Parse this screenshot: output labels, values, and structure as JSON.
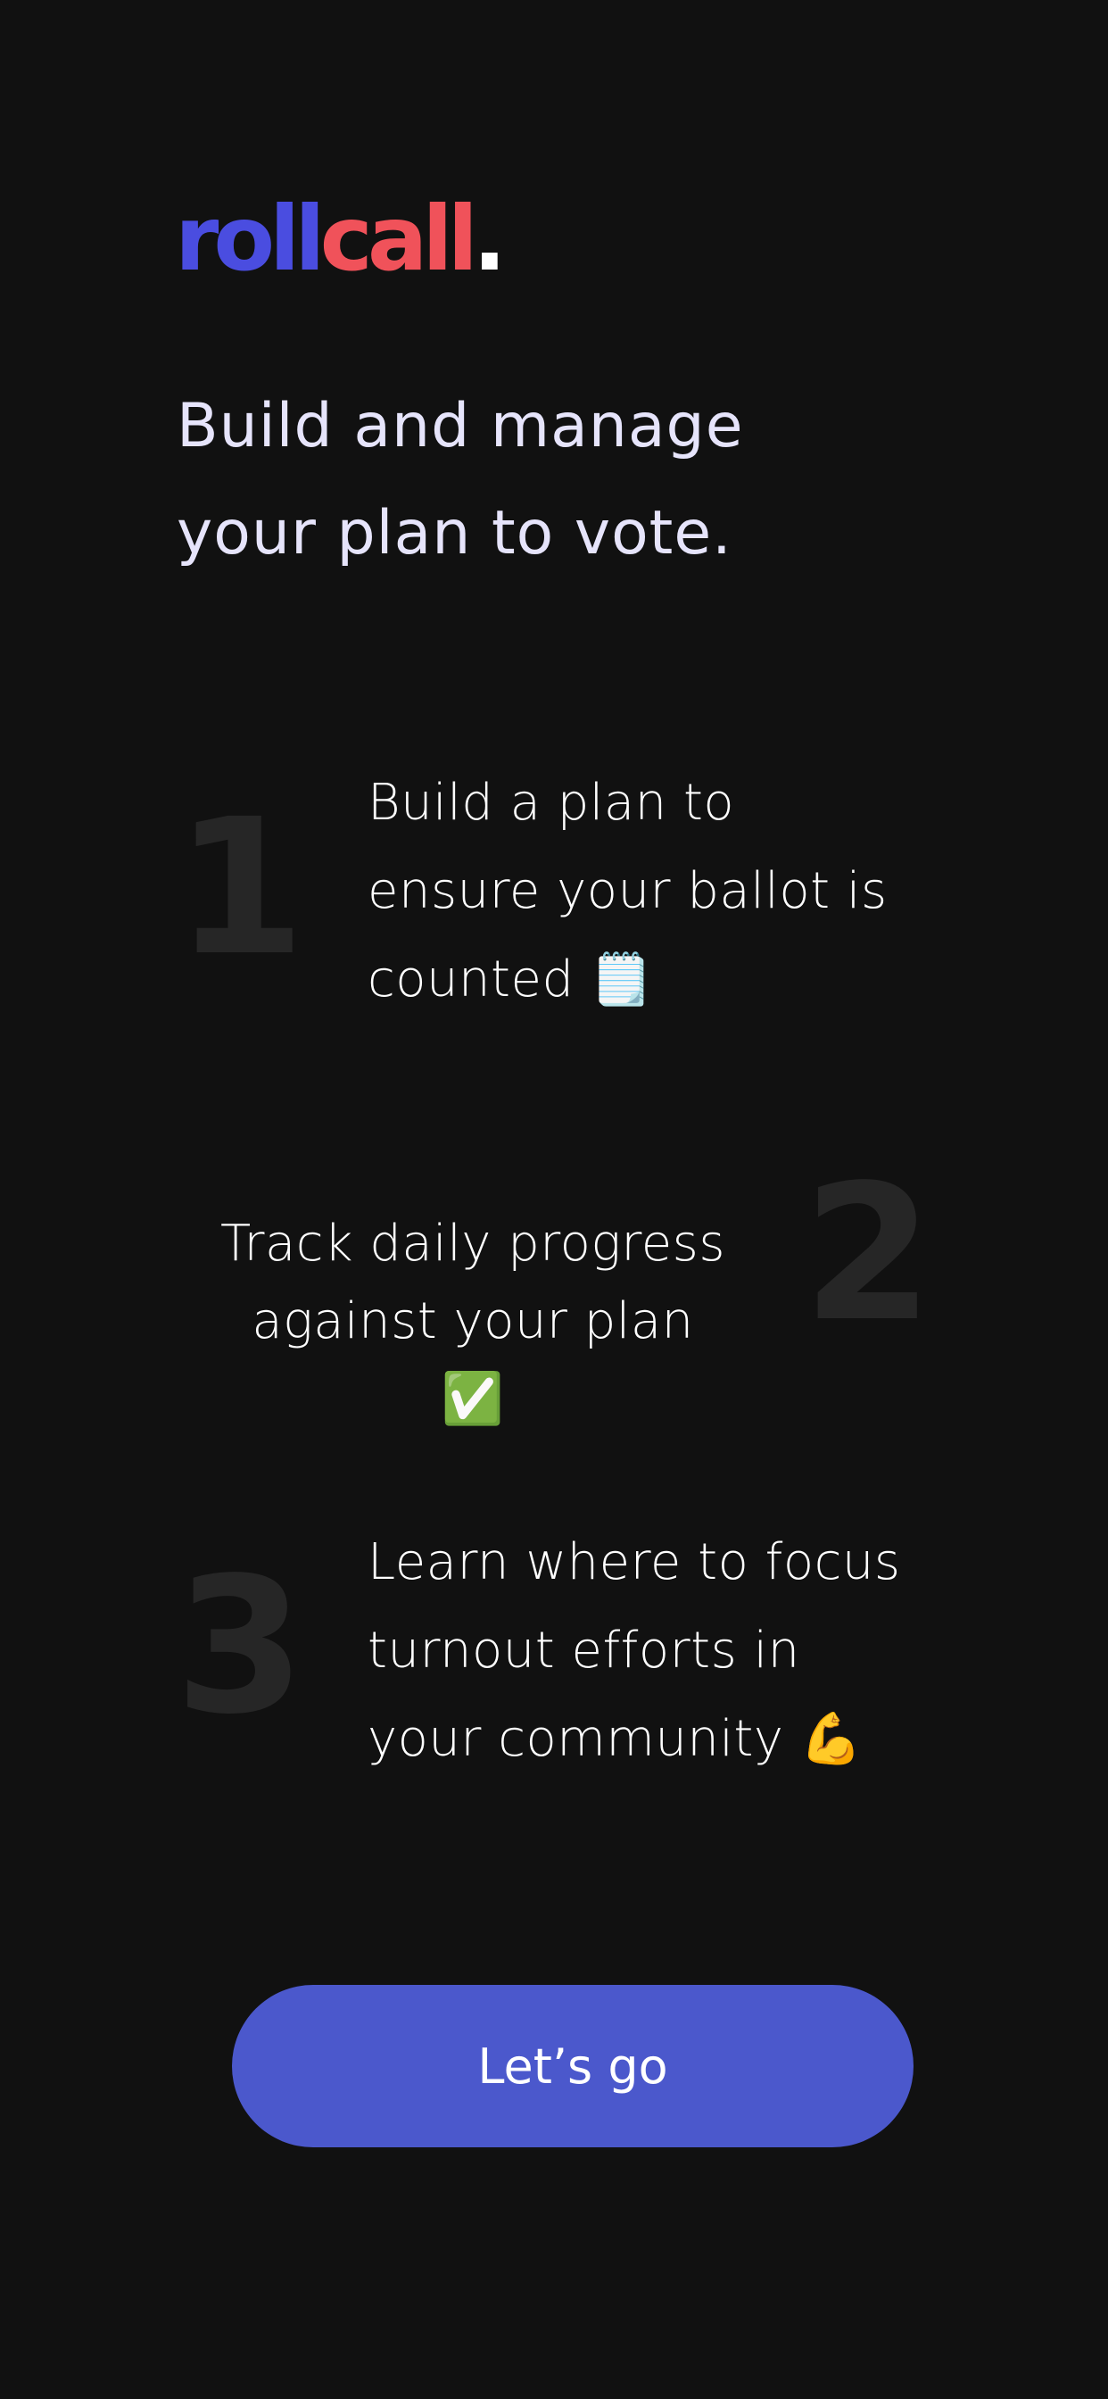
{
  "brand": {
    "logo_part1": "roll",
    "logo_part2": "call",
    "logo_dot": ".",
    "colors": {
      "roll": "#4a4de0",
      "call": "#f0525a",
      "dot": "#ffffff",
      "background": "#111111",
      "button": "#4b58cc"
    }
  },
  "headline": {
    "line1": "Build and manage",
    "line2": "your plan to vote."
  },
  "steps": [
    {
      "number": "1",
      "lines": [
        "Build a plan to",
        "ensure your ballot is",
        "counted 🗒️"
      ],
      "icon": "notepad-icon"
    },
    {
      "number": "2",
      "lines": [
        "Track daily progress",
        "against your plan ✅"
      ],
      "icon": "check-mark-icon"
    },
    {
      "number": "3",
      "lines": [
        "Learn where to focus",
        "turnout efforts in",
        "your community 💪"
      ],
      "icon": "flexed-biceps-icon"
    }
  ],
  "cta": {
    "label": "Let’s go"
  }
}
